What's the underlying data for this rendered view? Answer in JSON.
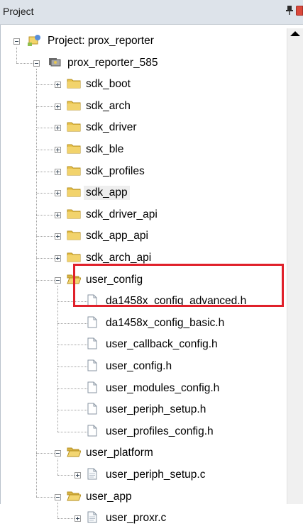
{
  "panel": {
    "title": "Project"
  },
  "tree": {
    "project": "Project: prox_reporter",
    "target": "prox_reporter_585",
    "groups": [
      "sdk_boot",
      "sdk_arch",
      "sdk_driver",
      "sdk_ble",
      "sdk_profiles",
      "sdk_app",
      "sdk_driver_api",
      "sdk_app_api",
      "sdk_arch_api"
    ],
    "user_config": {
      "label": "user_config",
      "files": [
        "da1458x_config_advanced.h",
        "da1458x_config_basic.h",
        "user_callback_config.h",
        "user_config.h",
        "user_modules_config.h",
        "user_periph_setup.h",
        "user_profiles_config.h"
      ]
    },
    "user_platform": {
      "label": "user_platform",
      "files": [
        "user_periph_setup.c"
      ]
    },
    "user_app": {
      "label": "user_app",
      "files": [
        "user_proxr.c"
      ]
    }
  },
  "selected_item": "sdk_app",
  "highlighted_items": [
    "da1458x_config_advanced.h",
    "da1458x_config_basic.h"
  ],
  "colors": {
    "highlight_box": "#e0202a",
    "folder": "#e8c24a",
    "titlebar": "#dde3ea"
  },
  "icons": [
    "pin-icon",
    "close-icon",
    "scroll-up-arrow-icon",
    "project-icon",
    "target-icon",
    "folder-icon",
    "open-folder-icon",
    "file-icon",
    "source-file-icon"
  ]
}
